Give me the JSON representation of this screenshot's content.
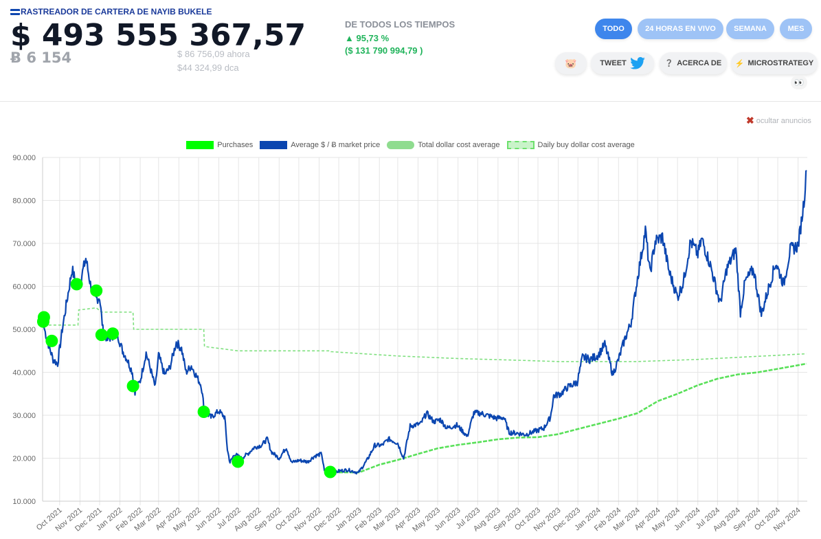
{
  "header": {
    "title": "RASTREADOR DE CARTERA DE NAYIB BUKELE",
    "value_usd": "$ 493 555 367,57",
    "value_btc": "Ƀ 6 154",
    "price_now": "$ 86 756,09",
    "price_now_label": "ahora",
    "dca": "$44 324,99",
    "dca_label": "dca",
    "ath_title": "DE TODOS LOS TIEMPOS",
    "ath_pct": "▲ 95,73 %",
    "ath_usd": "($ 131 790 994,79 )"
  },
  "tabs": [
    {
      "label": "TODO",
      "active": true
    },
    {
      "label": "24 HORAS EN VIVO",
      "active": false
    },
    {
      "label": "SEMANA",
      "active": false
    },
    {
      "label": "MES",
      "active": false
    }
  ],
  "actions": {
    "piggy": "🐷",
    "tweet": "TWEET",
    "about": "ACERCA DE",
    "about_icon": "❓",
    "microstrategy": "MICROSTRATEGY",
    "microstrategy_icon": "⚡",
    "eyes": "👀"
  },
  "ads": {
    "hide_label": "ocultar anuncios"
  },
  "chart_data": {
    "type": "line",
    "y_ticks": [
      "10.000",
      "20.000",
      "30.000",
      "40.000",
      "50.000",
      "60.000",
      "70.000",
      "80.000",
      "90.000"
    ],
    "ylim": [
      10000,
      90000
    ],
    "x_ticks": [
      "Oct 2021",
      "Nov 2021",
      "Dec 2021",
      "Jan 2022",
      "Feb 2022",
      "Mar 2022",
      "Apr 2022",
      "May 2022",
      "Jun 2022",
      "Jul 2022",
      "Aug 2022",
      "Sep 2022",
      "Oct 2022",
      "Nov 2022",
      "Dec 2022",
      "Jan 2023",
      "Feb 2023",
      "Mar 2023",
      "Apr 2023",
      "May 2023",
      "Jun 2023",
      "Jul 2023",
      "Aug 2023",
      "Sep 2023",
      "Oct 2023",
      "Nov 2023",
      "Dec 2023",
      "Jan 2024",
      "Feb 2024",
      "Mar 2024",
      "Apr 2024",
      "May 2024",
      "Jun 2024",
      "Jul 2024",
      "Aug 2024",
      "Sep 2024",
      "Oct 2024",
      "Nov 2024"
    ],
    "legend": [
      {
        "name": "Purchases",
        "color": "#00ff00"
      },
      {
        "name": "Average $ / Ƀ market price",
        "color": "#0b46b0"
      },
      {
        "name": "Total dollar cost average",
        "color": "#8fdc8f"
      },
      {
        "name": "Daily buy dollar cost average",
        "color": "#6de06d"
      }
    ],
    "colors": {
      "price": "#0b46b0",
      "purchases": "#00ff00",
      "total_dca": "#59e059",
      "daily_dca": "#7fe07f"
    },
    "price": [
      [
        "2021-09-07",
        50500
      ],
      [
        "2021-09-14",
        46500
      ],
      [
        "2021-09-21",
        43000
      ],
      [
        "2021-09-28",
        42000
      ],
      [
        "2021-10-05",
        50000
      ],
      [
        "2021-10-12",
        56500
      ],
      [
        "2021-10-20",
        64000
      ],
      [
        "2021-10-27",
        60000
      ],
      [
        "2021-11-03",
        62000
      ],
      [
        "2021-11-10",
        66500
      ],
      [
        "2021-11-17",
        60500
      ],
      [
        "2021-11-24",
        57000
      ],
      [
        "2021-12-01",
        57500
      ],
      [
        "2021-12-06",
        50000
      ],
      [
        "2021-12-13",
        47500
      ],
      [
        "2021-12-20",
        48500
      ],
      [
        "2021-12-28",
        49000
      ],
      [
        "2022-01-05",
        45000
      ],
      [
        "2022-01-12",
        43000
      ],
      [
        "2022-01-20",
        40000
      ],
      [
        "2022-01-24",
        35500
      ],
      [
        "2022-02-01",
        38000
      ],
      [
        "2022-02-10",
        44500
      ],
      [
        "2022-02-18",
        40000
      ],
      [
        "2022-02-24",
        36500
      ],
      [
        "2022-03-01",
        44000
      ],
      [
        "2022-03-10",
        39500
      ],
      [
        "2022-03-18",
        41000
      ],
      [
        "2022-03-28",
        47000
      ],
      [
        "2022-04-05",
        45500
      ],
      [
        "2022-04-12",
        40000
      ],
      [
        "2022-04-20",
        41500
      ],
      [
        "2022-04-28",
        39000
      ],
      [
        "2022-05-05",
        37000
      ],
      [
        "2022-05-10",
        31000
      ],
      [
        "2022-05-20",
        29500
      ],
      [
        "2022-06-01",
        31000
      ],
      [
        "2022-06-10",
        29500
      ],
      [
        "2022-06-14",
        22000
      ],
      [
        "2022-06-18",
        19000
      ],
      [
        "2022-06-25",
        21000
      ],
      [
        "2022-07-05",
        20000
      ],
      [
        "2022-07-15",
        21000
      ],
      [
        "2022-07-25",
        22500
      ],
      [
        "2022-08-05",
        23000
      ],
      [
        "2022-08-14",
        24500
      ],
      [
        "2022-08-20",
        21500
      ],
      [
        "2022-09-01",
        20000
      ],
      [
        "2022-09-12",
        22500
      ],
      [
        "2022-09-20",
        19000
      ],
      [
        "2022-10-01",
        19500
      ],
      [
        "2022-10-15",
        19200
      ],
      [
        "2022-10-25",
        20500
      ],
      [
        "2022-11-05",
        21000
      ],
      [
        "2022-11-09",
        17000
      ],
      [
        "2022-11-20",
        16300
      ],
      [
        "2022-12-01",
        17000
      ],
      [
        "2022-12-15",
        17300
      ],
      [
        "2022-12-31",
        16600
      ],
      [
        "2023-01-13",
        19500
      ],
      [
        "2023-01-25",
        23000
      ],
      [
        "2023-02-05",
        23000
      ],
      [
        "2023-02-15",
        24500
      ],
      [
        "2023-03-01",
        23500
      ],
      [
        "2023-03-10",
        20000
      ],
      [
        "2023-03-20",
        27500
      ],
      [
        "2023-04-05",
        28000
      ],
      [
        "2023-04-14",
        30500
      ],
      [
        "2023-04-25",
        28500
      ],
      [
        "2023-05-05",
        29000
      ],
      [
        "2023-05-15",
        27000
      ],
      [
        "2023-05-30",
        27700
      ],
      [
        "2023-06-10",
        26000
      ],
      [
        "2023-06-15",
        25000
      ],
      [
        "2023-06-25",
        30500
      ],
      [
        "2023-07-05",
        30500
      ],
      [
        "2023-07-15",
        30000
      ],
      [
        "2023-07-30",
        29300
      ],
      [
        "2023-08-10",
        29500
      ],
      [
        "2023-08-18",
        26000
      ],
      [
        "2023-09-01",
        25800
      ],
      [
        "2023-09-12",
        25500
      ],
      [
        "2023-09-25",
        26200
      ],
      [
        "2023-10-10",
        27000
      ],
      [
        "2023-10-20",
        29500
      ],
      [
        "2023-10-25",
        34500
      ],
      [
        "2023-11-05",
        35000
      ],
      [
        "2023-11-15",
        36500
      ],
      [
        "2023-11-30",
        37700
      ],
      [
        "2023-12-08",
        43500
      ],
      [
        "2023-12-20",
        43000
      ],
      [
        "2024-01-01",
        44000
      ],
      [
        "2024-01-11",
        46500
      ],
      [
        "2024-01-20",
        41500
      ],
      [
        "2024-01-23",
        39500
      ],
      [
        "2024-02-01",
        43000
      ],
      [
        "2024-02-10",
        47500
      ],
      [
        "2024-02-20",
        51500
      ],
      [
        "2024-03-01",
        62000
      ],
      [
        "2024-03-13",
        73000
      ],
      [
        "2024-03-20",
        63000
      ],
      [
        "2024-03-28",
        70500
      ],
      [
        "2024-04-08",
        71500
      ],
      [
        "2024-04-18",
        63500
      ],
      [
        "2024-05-01",
        57500
      ],
      [
        "2024-05-10",
        61000
      ],
      [
        "2024-05-21",
        70500
      ],
      [
        "2024-06-01",
        67500
      ],
      [
        "2024-06-07",
        71000
      ],
      [
        "2024-06-20",
        65000
      ],
      [
        "2024-07-05",
        56000
      ],
      [
        "2024-07-15",
        64000
      ],
      [
        "2024-07-29",
        68500
      ],
      [
        "2024-08-05",
        54000
      ],
      [
        "2024-08-12",
        61000
      ],
      [
        "2024-08-25",
        64000
      ],
      [
        "2024-09-06",
        53500
      ],
      [
        "2024-09-15",
        58500
      ],
      [
        "2024-09-28",
        65500
      ],
      [
        "2024-10-10",
        60500
      ],
      [
        "2024-10-20",
        68500
      ],
      [
        "2024-11-01",
        69500
      ],
      [
        "2024-11-06",
        75000
      ],
      [
        "2024-11-10",
        80000
      ],
      [
        "2024-11-14",
        87000
      ]
    ],
    "purchases": [
      [
        "2021-09-06",
        51800
      ],
      [
        "2021-09-07",
        52800
      ],
      [
        "2021-09-19",
        47300
      ],
      [
        "2021-10-27",
        60500
      ],
      [
        "2021-11-26",
        59000
      ],
      [
        "2021-12-04",
        48700
      ],
      [
        "2021-12-21",
        49000
      ],
      [
        "2022-01-21",
        36800
      ],
      [
        "2022-05-09",
        30800
      ],
      [
        "2022-06-30",
        19200
      ],
      [
        "2022-11-18",
        16800
      ]
    ],
    "total_dca": [
      [
        "2022-12-01",
        16700
      ],
      [
        "2023-01-01",
        16700
      ],
      [
        "2023-02-01",
        18500
      ],
      [
        "2023-03-01",
        19600
      ],
      [
        "2023-04-01",
        21000
      ],
      [
        "2023-05-01",
        22300
      ],
      [
        "2023-06-01",
        23100
      ],
      [
        "2023-07-01",
        23700
      ],
      [
        "2023-08-01",
        24400
      ],
      [
        "2023-09-01",
        24800
      ],
      [
        "2023-10-01",
        24900
      ],
      [
        "2023-11-01",
        25600
      ],
      [
        "2023-12-01",
        26800
      ],
      [
        "2024-01-01",
        28000
      ],
      [
        "2024-02-01",
        29200
      ],
      [
        "2024-03-01",
        30500
      ],
      [
        "2024-04-01",
        33300
      ],
      [
        "2024-05-01",
        35000
      ],
      [
        "2024-06-01",
        37000
      ],
      [
        "2024-07-01",
        38500
      ],
      [
        "2024-08-01",
        39500
      ],
      [
        "2024-09-01",
        40000
      ],
      [
        "2024-10-01",
        40800
      ],
      [
        "2024-11-14",
        42000
      ]
    ],
    "daily_dca": [
      [
        "2021-09-07",
        51000
      ],
      [
        "2021-10-29",
        51000
      ],
      [
        "2021-10-30",
        54500
      ],
      [
        "2021-11-26",
        55000
      ],
      [
        "2021-12-04",
        54000
      ],
      [
        "2022-01-21",
        54000
      ],
      [
        "2022-01-22",
        50000
      ],
      [
        "2022-05-09",
        50000
      ],
      [
        "2022-05-10",
        46000
      ],
      [
        "2022-06-30",
        45000
      ],
      [
        "2022-11-18",
        45000
      ],
      [
        "2022-11-19",
        44800
      ],
      [
        "2023-03-01",
        43800
      ],
      [
        "2023-06-01",
        43200
      ],
      [
        "2023-09-01",
        42800
      ],
      [
        "2023-11-01",
        42500
      ],
      [
        "2024-03-01",
        42500
      ],
      [
        "2024-06-01",
        43000
      ],
      [
        "2024-11-14",
        44300
      ]
    ]
  }
}
